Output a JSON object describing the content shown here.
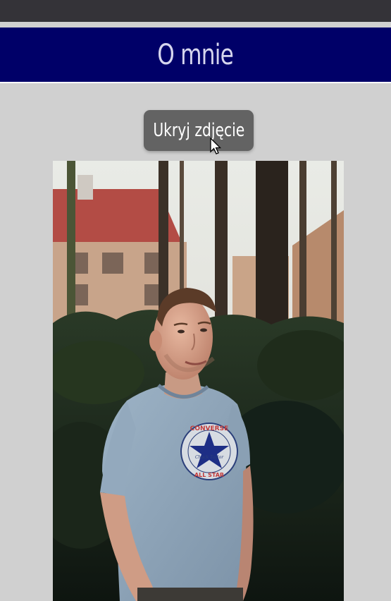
{
  "header": {
    "title": "O mnie"
  },
  "toggle_button": {
    "label": "Ukryj zdjęcie"
  },
  "photo": {
    "subject": "portrait-photo",
    "shirt_logo_top": "CONVERSE",
    "shirt_logo_bottom": "ALL STAR",
    "shirt_logo_script": "Chuck Taylor"
  },
  "colors": {
    "topbar": "#343338",
    "header_bg": "#000068",
    "header_text": "#d6d6ee",
    "page_bg": "#d0d0d0",
    "button_bg": "#636363"
  }
}
